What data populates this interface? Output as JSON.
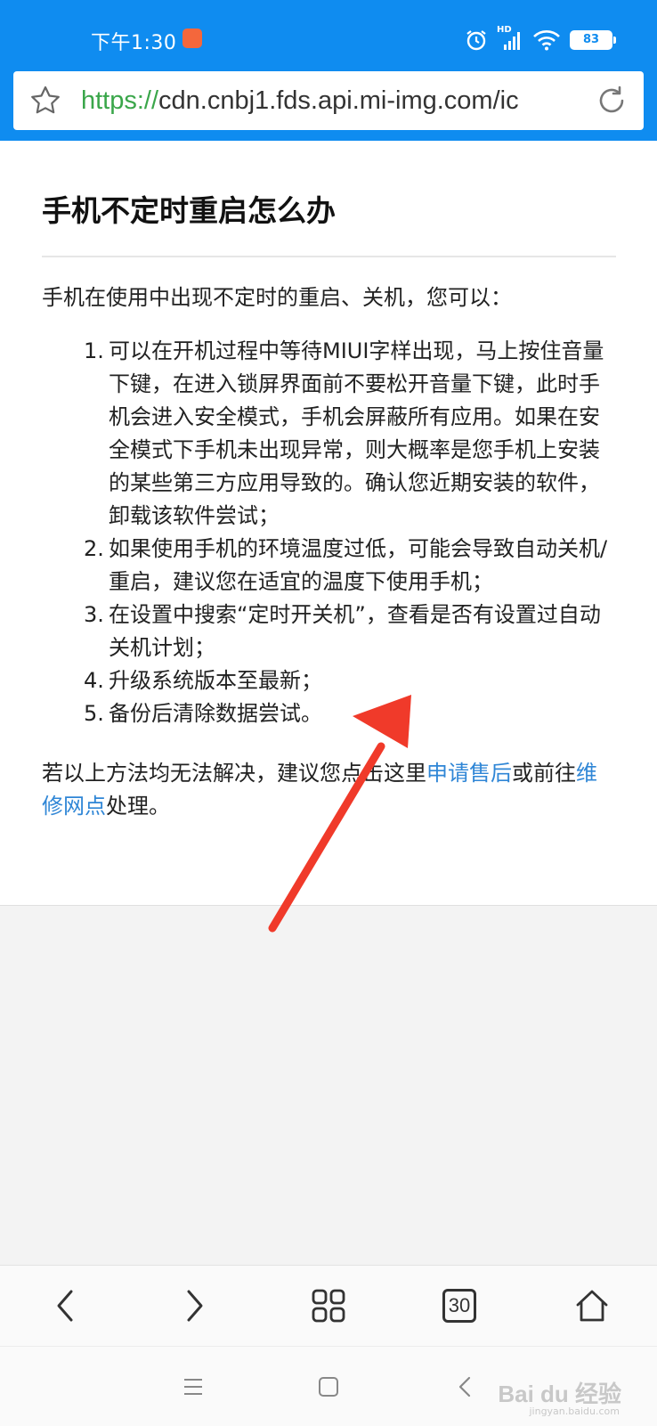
{
  "status_bar": {
    "time": "下午1:30",
    "network_badge": "HD",
    "battery": "83"
  },
  "address_bar": {
    "scheme": "https://",
    "host_path": "cdn.cnbj1.fds.api.mi-img.com/ic"
  },
  "article": {
    "title": "手机不定时重启怎么办",
    "intro": "手机在使用中出现不定时的重启、关机，您可以：",
    "steps": [
      {
        "num": "1.",
        "text": "可以在开机过程中等待MIUI字样出现，马上按住音量下键，在进入锁屏界面前不要松开音量下键，此时手机会进入安全模式，手机会屏蔽所有应用。如果在安全模式下手机未出现异常，则大概率是您手机上安装的某些第三方应用导致的。确认您近期安装的软件，卸载该软件尝试；"
      },
      {
        "num": "2.",
        "text": "如果使用手机的环境温度过低，可能会导致自动关机/重启，建议您在适宜的温度下使用手机；"
      },
      {
        "num": "3.",
        "text": "在设置中搜索“定时开关机”，查看是否有设置过自动关机计划；"
      },
      {
        "num": "4.",
        "text": "升级系统版本至最新；"
      },
      {
        "num": "5.",
        "text": "备份后清除数据尝试。"
      }
    ],
    "outro_before": "若以上方法均无法解决，建议您点击这里",
    "link_after_sales": "申请售后",
    "outro_middle": "或前往",
    "link_repair": "维修网点",
    "outro_after": "处理。"
  },
  "bottom_toolbar": {
    "tab_count": "30",
    "icons": [
      "back-icon",
      "forward-icon",
      "grid-menu-icon",
      "tabs-icon",
      "home-icon"
    ]
  },
  "watermark": {
    "brand": "Bai du 经验",
    "site": "jingyan.baidu.com"
  },
  "colors": {
    "status_bar": "#0f8cf0",
    "link": "#2f86d6",
    "url_scheme": "#3aa64a",
    "annotation_arrow": "#f03a2a"
  }
}
